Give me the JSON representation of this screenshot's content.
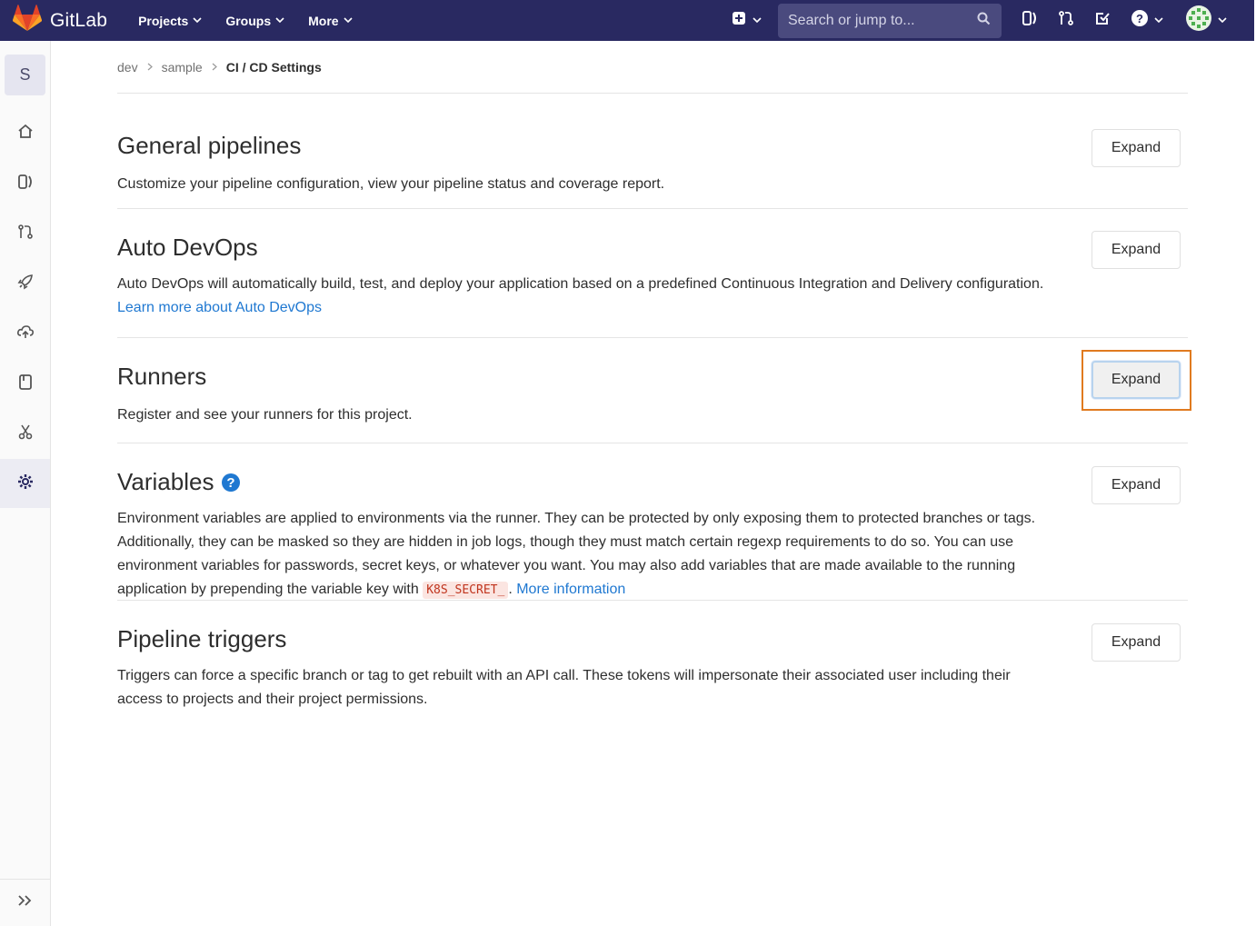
{
  "navbar": {
    "brand": "GitLab",
    "menu": [
      {
        "label": "Projects"
      },
      {
        "label": "Groups"
      },
      {
        "label": "More"
      }
    ],
    "search_placeholder": "Search or jump to...",
    "icons": [
      "plus-square-icon",
      "chevron-down-icon",
      "search-icon",
      "issues-icon",
      "merge-request-icon",
      "todo-icon",
      "help-icon",
      "user-avatar"
    ]
  },
  "sidebar": {
    "project_initial": "S",
    "items": [
      "home-icon",
      "issues-icon",
      "merge-request-icon",
      "rocket-icon",
      "cloud-icon",
      "document-icon",
      "scissors-icon",
      "settings-icon"
    ],
    "active": "settings-icon"
  },
  "breadcrumb": {
    "items": [
      "dev",
      "sample"
    ],
    "current": "CI / CD Settings"
  },
  "sections": [
    {
      "title": "General pipelines",
      "description": "Customize your pipeline configuration, view your pipeline status and coverage report.",
      "button": "Expand"
    },
    {
      "title": "Auto DevOps",
      "description": "Auto DevOps will automatically build, test, and deploy your application based on a predefined Continuous Integration and Delivery configuration.",
      "link": "Learn more about Auto DevOps",
      "button": "Expand"
    },
    {
      "title": "Runners",
      "description": "Register and see your runners for this project.",
      "button": "Expand"
    },
    {
      "title": "Variables",
      "description": "Environment variables are applied to environments via the runner. They can be protected by only exposing them to protected branches or tags. Additionally, they can be masked so they are hidden in job logs, though they must match certain regexp requirements to do so. You can use environment variables for passwords, secret keys, or whatever you want. You may also add variables that are made available to the running application by prepending the variable key with",
      "code": "K8S_SECRET_",
      "after_code": ".",
      "link": "More information",
      "button": "Expand"
    },
    {
      "title": "Pipeline triggers",
      "description": "Triggers can force a specific branch or tag to get rebuilt with an API call. These tokens will impersonate their associated user including their access to projects and their project permissions.",
      "button": "Expand"
    }
  ],
  "colors": {
    "navbar_bg": "#292961",
    "link": "#1f78d1",
    "highlight": "#e07a1f"
  }
}
